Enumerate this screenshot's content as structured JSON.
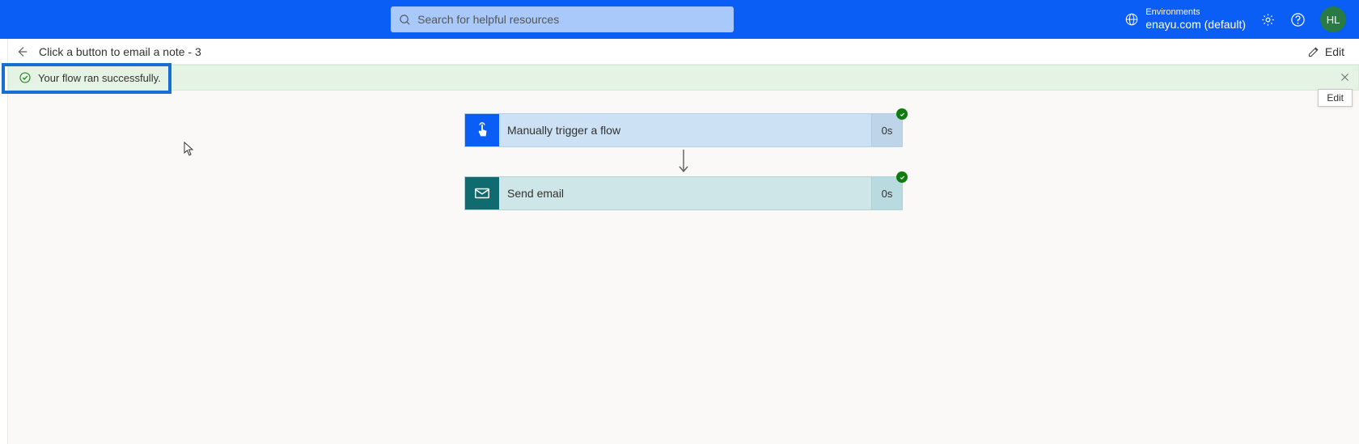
{
  "header": {
    "search_placeholder": "Search for helpful resources",
    "env_label": "Environments",
    "env_name": "enayu.com (default)",
    "avatar_initials": "HL"
  },
  "breadcrumb": {
    "title": "Click a button to email a note - 3",
    "edit_label": "Edit"
  },
  "banner": {
    "message": "Your flow ran successfully."
  },
  "tooltip": {
    "text": "Edit"
  },
  "steps": [
    {
      "label": "Manually trigger a flow",
      "timing": "0s"
    },
    {
      "label": "Send email",
      "timing": "0s"
    }
  ]
}
